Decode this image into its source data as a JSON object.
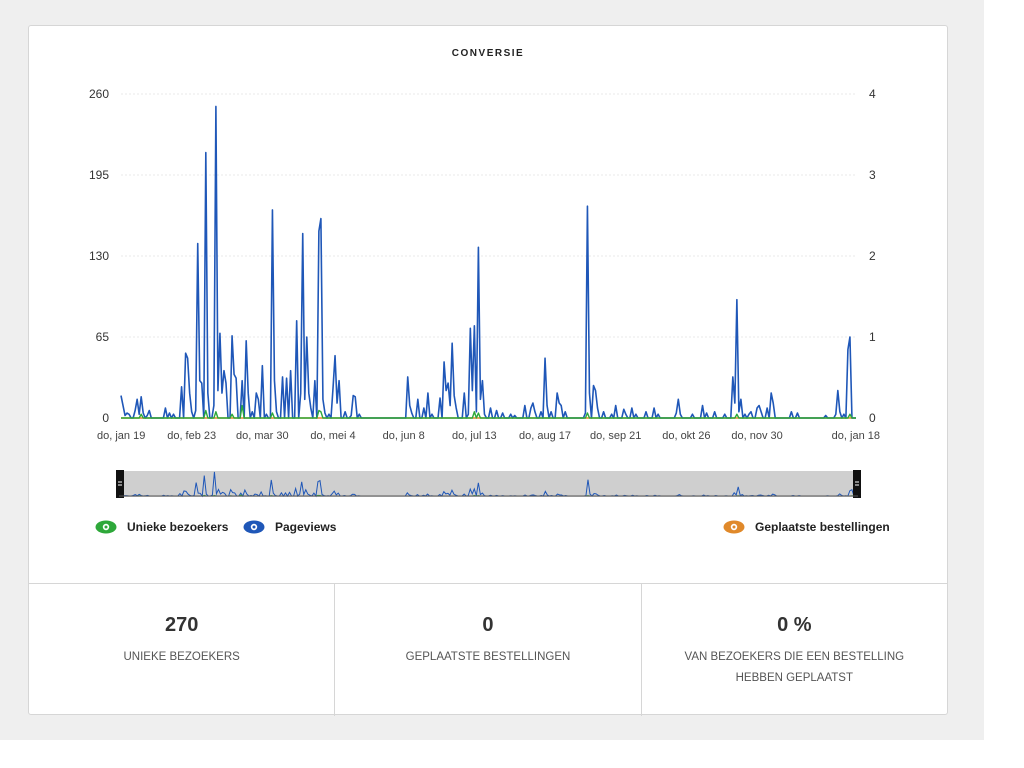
{
  "colors": {
    "unique_visitors": "#2ea83a",
    "pageviews": "#1f57b8",
    "orders": "#e0892a",
    "grid": "#e8e8e8",
    "navigator_bg": "#cfcfcf"
  },
  "chart_data": {
    "type": "line",
    "title": "CONVERSIE",
    "xlabel": "",
    "ylabel_left": "",
    "ylabel_right": "",
    "ylim_left": [
      0,
      260
    ],
    "ylim_right": [
      0,
      4
    ],
    "yticks_left": [
      "260",
      "195",
      "130",
      "65",
      "0"
    ],
    "yticks_right": [
      "4",
      "3",
      "2",
      "1",
      "0"
    ],
    "x_ticks": [
      "do, jan 19",
      "do, feb 23",
      "do, mar 30",
      "do, mei 4",
      "do, jun 8",
      "do, jul 13",
      "do, aug 17",
      "do, sep 21",
      "do, okt 26",
      "do, nov 30",
      "do, jan 18"
    ],
    "x_index_ticks": [
      0,
      35,
      70,
      105,
      140,
      175,
      210,
      245,
      280,
      315,
      364
    ],
    "n_days": 365,
    "grid": true,
    "legend_position": "bottom",
    "series": [
      {
        "name": "Pageviews",
        "axis": "left",
        "spikes": [
          [
            0,
            18
          ],
          [
            1,
            10
          ],
          [
            2,
            2
          ],
          [
            3,
            4
          ],
          [
            4,
            3
          ],
          [
            7,
            6
          ],
          [
            8,
            15
          ],
          [
            9,
            3
          ],
          [
            10,
            17
          ],
          [
            11,
            4
          ],
          [
            13,
            2
          ],
          [
            14,
            6
          ],
          [
            22,
            8
          ],
          [
            24,
            4
          ],
          [
            26,
            3
          ],
          [
            30,
            25
          ],
          [
            32,
            52
          ],
          [
            33,
            48
          ],
          [
            34,
            20
          ],
          [
            35,
            5
          ],
          [
            37,
            6
          ],
          [
            38,
            140
          ],
          [
            39,
            30
          ],
          [
            40,
            28
          ],
          [
            42,
            213
          ],
          [
            43,
            20
          ],
          [
            46,
            10
          ],
          [
            47,
            250
          ],
          [
            48,
            22
          ],
          [
            49,
            68
          ],
          [
            50,
            20
          ],
          [
            51,
            38
          ],
          [
            52,
            28
          ],
          [
            55,
            66
          ],
          [
            56,
            35
          ],
          [
            57,
            32
          ],
          [
            60,
            30
          ],
          [
            62,
            62
          ],
          [
            63,
            20
          ],
          [
            65,
            5
          ],
          [
            67,
            20
          ],
          [
            68,
            15
          ],
          [
            70,
            42
          ],
          [
            72,
            3
          ],
          [
            75,
            167
          ],
          [
            76,
            30
          ],
          [
            77,
            5
          ],
          [
            80,
            33
          ],
          [
            82,
            32
          ],
          [
            84,
            38
          ],
          [
            87,
            78
          ],
          [
            89,
            20
          ],
          [
            90,
            148
          ],
          [
            91,
            15
          ],
          [
            92,
            65
          ],
          [
            93,
            20
          ],
          [
            94,
            8
          ],
          [
            96,
            30
          ],
          [
            98,
            150
          ],
          [
            99,
            160
          ],
          [
            100,
            15
          ],
          [
            101,
            4
          ],
          [
            103,
            3
          ],
          [
            105,
            24
          ],
          [
            106,
            50
          ],
          [
            107,
            12
          ],
          [
            108,
            30
          ],
          [
            111,
            5
          ],
          [
            114,
            2
          ],
          [
            115,
            18
          ],
          [
            116,
            17
          ],
          [
            118,
            3
          ],
          [
            142,
            33
          ],
          [
            143,
            10
          ],
          [
            144,
            4
          ],
          [
            147,
            15
          ],
          [
            150,
            8
          ],
          [
            152,
            20
          ],
          [
            154,
            3
          ],
          [
            158,
            16
          ],
          [
            160,
            45
          ],
          [
            161,
            22
          ],
          [
            162,
            28
          ],
          [
            163,
            10
          ],
          [
            164,
            60
          ],
          [
            165,
            18
          ],
          [
            166,
            8
          ],
          [
            170,
            20
          ],
          [
            172,
            3
          ],
          [
            173,
            72
          ],
          [
            174,
            22
          ],
          [
            175,
            74
          ],
          [
            176,
            5
          ],
          [
            177,
            137
          ],
          [
            178,
            15
          ],
          [
            179,
            30
          ],
          [
            180,
            3
          ],
          [
            183,
            8
          ],
          [
            186,
            6
          ],
          [
            189,
            4
          ],
          [
            193,
            3
          ],
          [
            195,
            2
          ],
          [
            200,
            10
          ],
          [
            203,
            8
          ],
          [
            204,
            12
          ],
          [
            205,
            5
          ],
          [
            208,
            5
          ],
          [
            210,
            48
          ],
          [
            211,
            10
          ],
          [
            213,
            5
          ],
          [
            216,
            20
          ],
          [
            217,
            12
          ],
          [
            218,
            10
          ],
          [
            220,
            5
          ],
          [
            230,
            4
          ],
          [
            231,
            170
          ],
          [
            232,
            20
          ],
          [
            234,
            26
          ],
          [
            235,
            22
          ],
          [
            236,
            8
          ],
          [
            239,
            5
          ],
          [
            243,
            3
          ],
          [
            245,
            10
          ],
          [
            249,
            7
          ],
          [
            250,
            3
          ],
          [
            253,
            8
          ],
          [
            255,
            3
          ],
          [
            260,
            5
          ],
          [
            264,
            8
          ],
          [
            266,
            3
          ],
          [
            275,
            4
          ],
          [
            276,
            15
          ],
          [
            277,
            3
          ],
          [
            283,
            3
          ],
          [
            288,
            10
          ],
          [
            290,
            4
          ],
          [
            294,
            5
          ],
          [
            299,
            3
          ],
          [
            303,
            33
          ],
          [
            304,
            12
          ],
          [
            305,
            95
          ],
          [
            306,
            5
          ],
          [
            307,
            15
          ],
          [
            309,
            3
          ],
          [
            311,
            3
          ],
          [
            312,
            5
          ],
          [
            315,
            8
          ],
          [
            316,
            10
          ],
          [
            317,
            5
          ],
          [
            320,
            8
          ],
          [
            322,
            20
          ],
          [
            323,
            12
          ],
          [
            332,
            5
          ],
          [
            335,
            4
          ],
          [
            349,
            2
          ],
          [
            354,
            3
          ],
          [
            355,
            22
          ],
          [
            356,
            5
          ],
          [
            358,
            3
          ],
          [
            360,
            55
          ],
          [
            361,
            65
          ]
        ]
      },
      {
        "name": "Unieke bezoekers",
        "axis": "left",
        "spikes": [
          [
            10,
            3
          ],
          [
            42,
            6
          ],
          [
            47,
            5
          ],
          [
            55,
            3
          ],
          [
            60,
            10
          ],
          [
            75,
            4
          ],
          [
            98,
            6
          ],
          [
            99,
            5
          ],
          [
            175,
            5
          ],
          [
            177,
            4
          ],
          [
            231,
            4
          ],
          [
            305,
            3
          ],
          [
            361,
            3
          ]
        ]
      },
      {
        "name": "Geplaatste bestellingen",
        "axis": "right",
        "spikes": []
      }
    ]
  },
  "legend": {
    "unique_visitors": "Unieke bezoekers",
    "pageviews": "Pageviews",
    "orders": "Geplaatste bestellingen",
    "icon": "eye-icon"
  },
  "stats": [
    {
      "value": "270",
      "label": "UNIEKE BEZOEKERS"
    },
    {
      "value": "0",
      "label": "GEPLAATSTE BESTELLINGEN"
    },
    {
      "value": "0 %",
      "label": "VAN BEZOEKERS DIE EEN BESTELLING HEBBEN GEPLAATST"
    }
  ]
}
